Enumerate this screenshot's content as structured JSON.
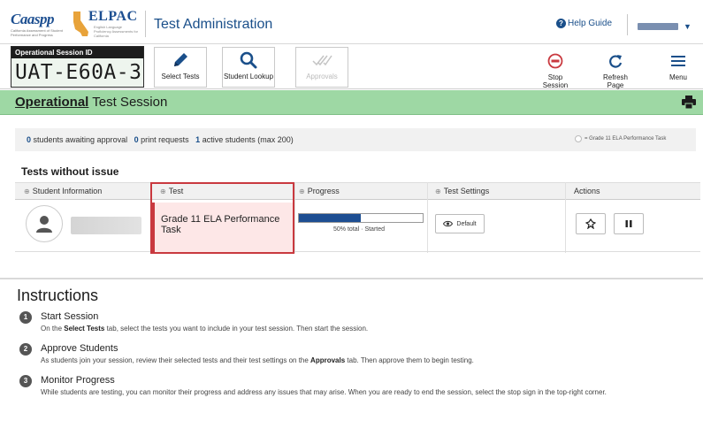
{
  "header": {
    "app_title": "Test Administration",
    "caaspp_logo": "Caaspp",
    "caaspp_subtitle": "California Assessment of Student Performance and Progress",
    "elpac_logo": "ELPAC",
    "elpac_subtitle": "English Language Proficiency Assessments for California",
    "help_guide": "Help Guide",
    "user_name": "blurred"
  },
  "session": {
    "id_label": "Operational Session ID",
    "id_value": "UAT-E60A-3",
    "tools": [
      {
        "label": "Select Tests",
        "icon": "pencil-icon",
        "enabled": true
      },
      {
        "label": "Student Lookup",
        "icon": "magnifier-icon",
        "enabled": true
      },
      {
        "label": "Approvals",
        "icon": "checkmarks-icon",
        "enabled": false
      }
    ],
    "right_tools": [
      {
        "label": "Stop Session",
        "icon": "stop-sign-icon"
      },
      {
        "label": "Refresh Page",
        "icon": "refresh-icon"
      },
      {
        "label": "Menu",
        "icon": "hamburger-icon"
      }
    ]
  },
  "page": {
    "title_strong": "Operational",
    "title_rest": " Test Session"
  },
  "stats": {
    "awaiting_count": "0",
    "awaiting_text": " students awaiting approval",
    "print_count": "0",
    "print_text": " print requests",
    "active_count": "1",
    "active_text": " active students (max 200)",
    "legend": "= Grade 11 ELA Performance Task"
  },
  "table": {
    "heading": "Tests without issue",
    "columns": [
      "Student Information",
      "Test",
      "Progress",
      "Test Settings",
      "Actions"
    ],
    "rows": [
      {
        "student": "blurred",
        "test": "Grade 11 ELA Performance Task",
        "progress_fraction": 0.5,
        "progress_total": "50% total",
        "progress_sep": "·",
        "progress_status": "Started",
        "settings": "Default"
      }
    ]
  },
  "instructions": {
    "heading": "Instructions",
    "steps": [
      {
        "num": "1",
        "title": "Start Session",
        "pre": "On the ",
        "bold": "Select Tests",
        "post": " tab, select the tests you want to include in your test session. Then start the session."
      },
      {
        "num": "2",
        "title": "Approve Students",
        "pre": "As students join your session, review their selected tests and their test settings on the ",
        "bold": "Approvals",
        "post": " tab. Then approve them to begin testing."
      },
      {
        "num": "3",
        "title": "Monitor Progress",
        "pre": "While students are testing, you can monitor their progress and address any issues that may arise. When you are ready to end the session, select the stop sign in the top-right corner.",
        "bold": "",
        "post": ""
      }
    ]
  },
  "colors": {
    "brand_blue": "#1a4f8a",
    "title_bar_green": "#9ed8a4",
    "highlight_red": "#c9393f",
    "progress_blue": "#1d4e92"
  }
}
